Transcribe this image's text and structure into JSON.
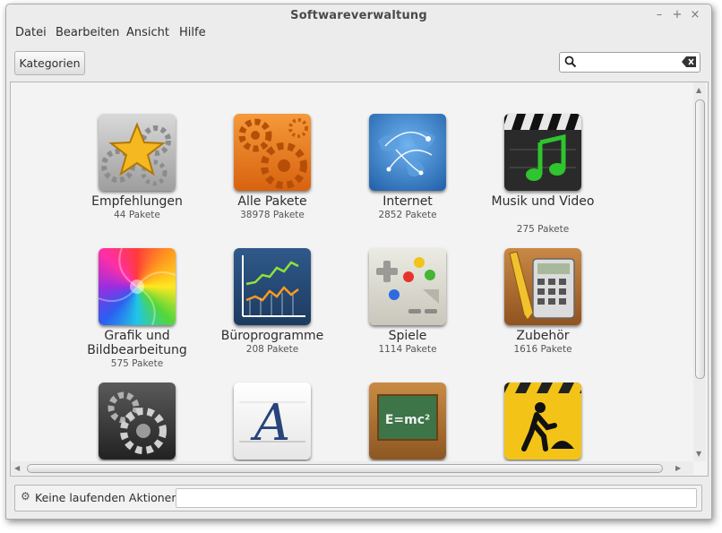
{
  "window": {
    "title": "Softwareverwaltung",
    "controls": [
      "–",
      "+",
      "×"
    ]
  },
  "menu": [
    {
      "label": "Datei"
    },
    {
      "label": "Bearbeiten"
    },
    {
      "label": "Ansicht"
    },
    {
      "label": "Hilfe"
    }
  ],
  "toolbar": {
    "categories_label": "Kategorien"
  },
  "search": {
    "value": "",
    "placeholder": ""
  },
  "categories": [
    {
      "name": "Empfehlungen",
      "count": "44 Pakete",
      "icon": "star-gears-icon"
    },
    {
      "name": "Alle Pakete",
      "count": "38978 Pakete",
      "icon": "orange-gears-icon"
    },
    {
      "name": "Internet",
      "count": "2852 Pakete",
      "icon": "globe-network-icon"
    },
    {
      "name": "Musik und Video",
      "count": "275 Pakete",
      "icon": "clapperboard-music-icon"
    },
    {
      "name": "Grafik und Bildbearbeitung",
      "count": "575 Pakete",
      "icon": "color-swirl-icon"
    },
    {
      "name": "Büroprogramme",
      "count": "208 Pakete",
      "icon": "line-chart-icon"
    },
    {
      "name": "Spiele",
      "count": "1114 Pakete",
      "icon": "gamepad-icon"
    },
    {
      "name": "Zubehör",
      "count": "1616 Pakete",
      "icon": "calculator-pencil-icon"
    },
    {
      "name": "",
      "count": "",
      "icon": "system-gears-icon"
    },
    {
      "name": "",
      "count": "",
      "icon": "font-letter-icon"
    },
    {
      "name": "",
      "count": "",
      "icon": "chalkboard-formula-icon"
    },
    {
      "name": "",
      "count": "",
      "icon": "construction-sign-icon"
    }
  ],
  "icon_text": {
    "formula": "E=mc²",
    "letter": "A"
  },
  "status": {
    "text": "Keine laufenden Aktionen"
  },
  "colors": {
    "accent_orange": "#e8781e",
    "internet_blue": "#2f7fd0",
    "office_navy": "#23466e"
  }
}
